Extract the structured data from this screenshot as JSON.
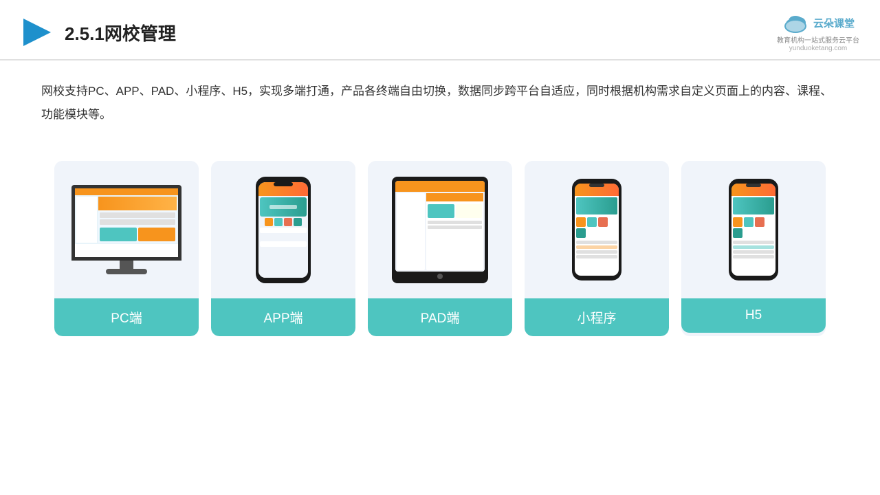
{
  "header": {
    "title": "2.5.1网校管理",
    "logo_text": "云朵课堂",
    "logo_domain": "yunduoketang.com",
    "logo_tagline": "教育机构一站\n式服务云平台"
  },
  "description": {
    "text": "网校支持PC、APP、PAD、小程序、H5，实现多端打通，产品各终端自由切换，数据同步跨平台自适应，同时根据机构需求自定义页面上的内容、课程、功能模块等。"
  },
  "cards": [
    {
      "id": "pc",
      "label": "PC端"
    },
    {
      "id": "app",
      "label": "APP端"
    },
    {
      "id": "pad",
      "label": "PAD端"
    },
    {
      "id": "miniprogram",
      "label": "小程序"
    },
    {
      "id": "h5",
      "label": "H5"
    }
  ],
  "accent_color": "#4ec5c0"
}
